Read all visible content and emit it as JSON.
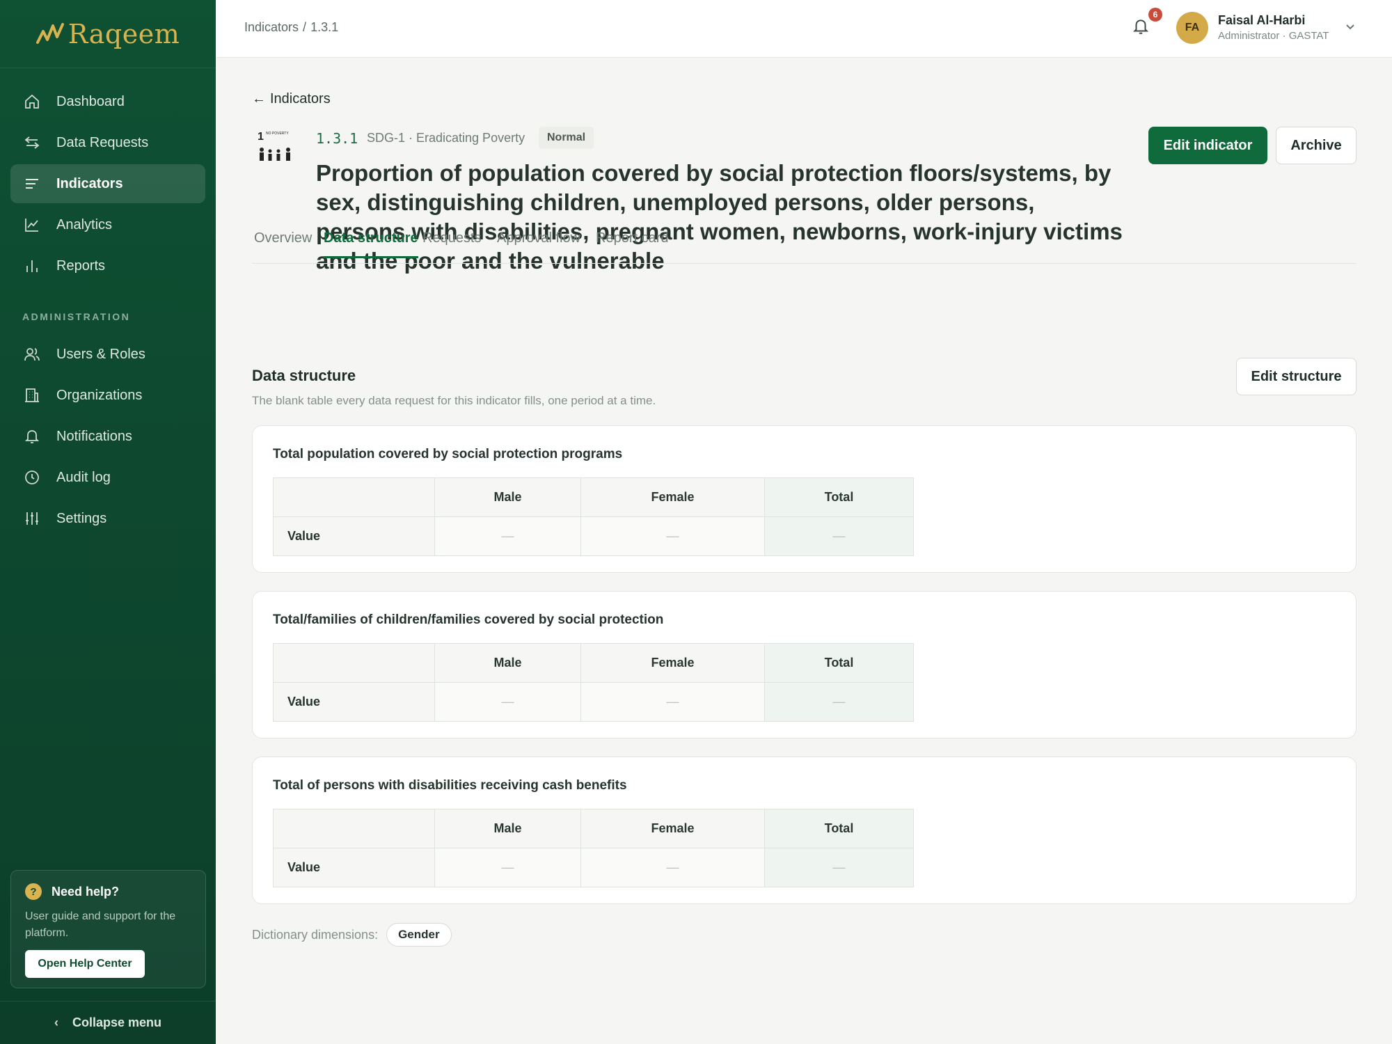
{
  "brand": {
    "name": "Raqeem"
  },
  "sidebar": {
    "items": [
      {
        "label": "Dashboard",
        "icon": "home-icon"
      },
      {
        "label": "Data Requests",
        "icon": "swap-arrows-icon"
      },
      {
        "label": "Indicators",
        "icon": "list-icon",
        "active": true
      },
      {
        "label": "Analytics",
        "icon": "line-chart-icon"
      },
      {
        "label": "Reports",
        "icon": "bar-chart-icon"
      }
    ],
    "admin_heading": "ADMINISTRATION",
    "admin_items": [
      {
        "label": "Users & Roles",
        "icon": "users-icon"
      },
      {
        "label": "Organizations",
        "icon": "building-icon"
      },
      {
        "label": "Notifications",
        "icon": "bell-icon"
      },
      {
        "label": "Audit log",
        "icon": "clock-icon"
      },
      {
        "label": "Settings",
        "icon": "sliders-icon"
      }
    ],
    "help": {
      "title": "Need help?",
      "icon_text": "?",
      "text": "User guide and support for the platform.",
      "button": "Open Help Center"
    },
    "collapse_label": "Collapse menu"
  },
  "topbar": {
    "breadcrumb": [
      "Indicators",
      "/",
      "1.3.1"
    ],
    "notification_count": "6",
    "user": {
      "initials": "FA",
      "name": "Faisal Al-Harbi",
      "role": "Administrator · GASTAT"
    }
  },
  "indicator": {
    "back_label": "Indicators",
    "code": "1.3.1",
    "meta": "SDG-1 · Eradicating Poverty",
    "priority": "Normal",
    "title": "Proportion of population covered by social protection floors/systems, by sex, distinguishing children, unemployed persons, older persons, persons with disabilities, pregnant women, newborns, work-injury victims and the poor and the vulnerable",
    "sdg_icon": {
      "number": "1",
      "label": "NO POVERTY"
    },
    "edit_label": "Edit indicator",
    "archive_label": "Archive"
  },
  "tabs": [
    {
      "label": "Overview"
    },
    {
      "label": "Data structure",
      "active": true
    },
    {
      "label": "Requests"
    },
    {
      "label": "Approval flow"
    },
    {
      "label": "Report card"
    }
  ],
  "data_structure": {
    "title": "Data structure",
    "subtitle": "The blank table every data request for this indicator fills, one period at a time.",
    "edit_label": "Edit structure",
    "columns": [
      "Male",
      "Female",
      "Total"
    ],
    "row_label": "Value",
    "empty": "—",
    "tables": [
      {
        "title": "Total population covered by social protection programs"
      },
      {
        "title": "Total/families of children/families covered by social protection"
      },
      {
        "title": "Total of persons with disabilities receiving cash benefits"
      }
    ],
    "dictionary_label": "Dictionary dimensions:",
    "dimensions": [
      "Gender"
    ]
  },
  "colors": {
    "sidebar": "#0f5133",
    "accent": "#0f6a3c",
    "gold": "#d8b34f",
    "badge": "#c94b3a"
  }
}
